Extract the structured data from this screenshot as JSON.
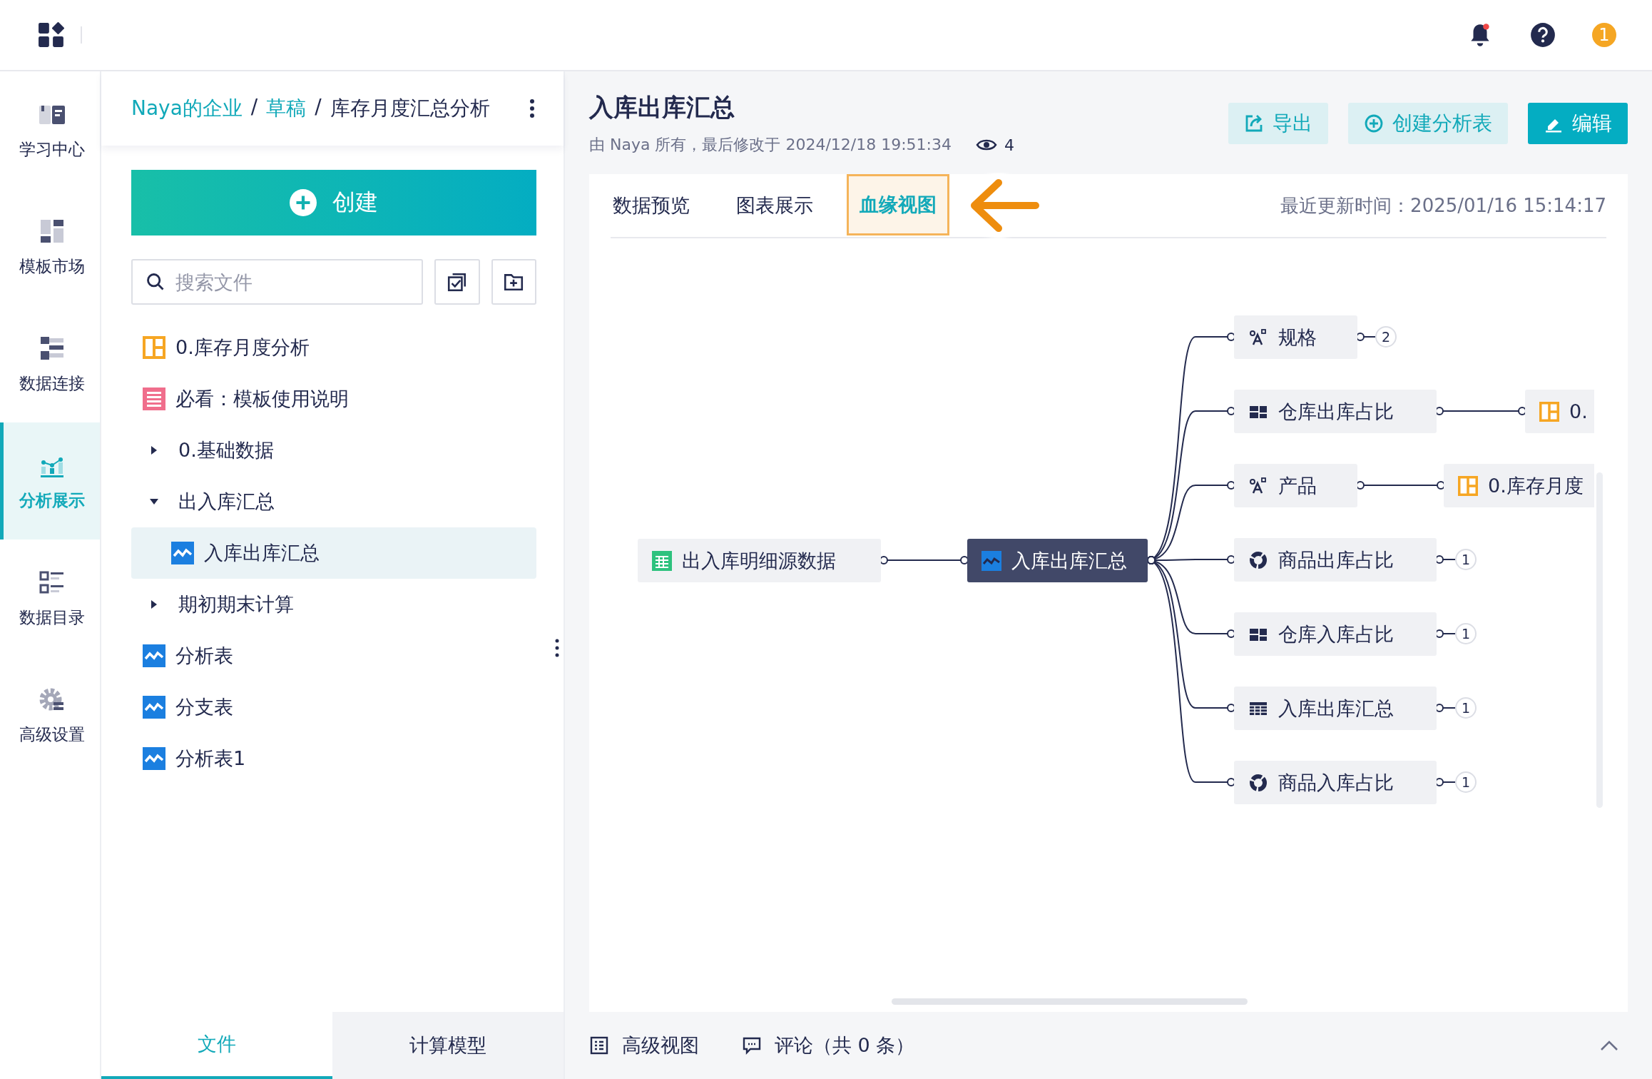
{
  "top_bar": {
    "user_badge": "1"
  },
  "nav_rail": [
    {
      "label": "学习中心",
      "kind": "book",
      "selected": false
    },
    {
      "label": "模板市场",
      "kind": "template",
      "selected": false
    },
    {
      "label": "数据连接",
      "kind": "connect",
      "selected": false
    },
    {
      "label": "分析展示",
      "kind": "chart",
      "selected": true
    },
    {
      "label": "数据目录",
      "kind": "catalog",
      "selected": false
    },
    {
      "label": "高级设置",
      "kind": "settings",
      "selected": false
    }
  ],
  "file_panel": {
    "breadcrumb": [
      {
        "label": "Naya的企业",
        "link": true
      },
      {
        "sep": "/",
        "label": "草稿",
        "link": true
      },
      {
        "sep": "/",
        "label": "库存月度汇总分析",
        "link": false
      }
    ],
    "create_button": "创建",
    "search": {
      "placeholder": "搜索文件"
    },
    "tree": [
      {
        "label": "0.库存月度分析",
        "kind": "dashboard",
        "selected": false
      },
      {
        "label": "必看：模板使用说明",
        "kind": "doc",
        "selected": false
      },
      {
        "label": "0.基础数据",
        "kind": "folder",
        "expanded": false,
        "selected": false
      },
      {
        "label": "出入库汇总",
        "kind": "folder",
        "expanded": true,
        "selected": false,
        "children": [
          {
            "label": "入库出库汇总",
            "kind": "analysis",
            "selected": true
          }
        ]
      },
      {
        "label": "期初期末计算",
        "kind": "folder",
        "expanded": false,
        "selected": false
      },
      {
        "label": "分析表",
        "kind": "analysis",
        "selected": false
      },
      {
        "label": "分支表",
        "kind": "analysis",
        "selected": false
      },
      {
        "label": "分析表1",
        "kind": "analysis",
        "selected": false
      }
    ],
    "bottom_tabs": [
      {
        "label": "文件",
        "selected": true
      },
      {
        "label": "计算模型",
        "selected": false
      }
    ]
  },
  "header": {
    "title": "入库出库汇总",
    "subtitle": "由 Naya 所有，最后修改于 2024/12/18 19:51:34",
    "views": "4",
    "buttons": [
      {
        "label": "导出",
        "kind": "export"
      },
      {
        "label": "创建分析表",
        "kind": "create"
      },
      {
        "label": "编辑",
        "kind": "edit"
      }
    ]
  },
  "tabs": [
    {
      "label": "数据预览",
      "selected": false
    },
    {
      "label": "图表展示",
      "selected": false
    },
    {
      "label": "血缘视图",
      "selected": true
    }
  ],
  "last_updated": "最近更新时间：2025/01/16 15:14:17",
  "lineage": {
    "source": {
      "label": "出入库明细源数据"
    },
    "center": {
      "label": "入库出库汇总"
    },
    "targets": [
      {
        "label": "规格",
        "kind": "field",
        "count": "2"
      },
      {
        "label": "仓库出库占比",
        "kind": "dashboard",
        "downstream": {
          "label": "0."
        }
      },
      {
        "label": "产品",
        "kind": "field",
        "downstream": {
          "label": "0.库存月度"
        }
      },
      {
        "label": "商品出库占比",
        "kind": "pie",
        "count": "1"
      },
      {
        "label": "仓库入库占比",
        "kind": "dashboard",
        "count": "1"
      },
      {
        "label": "入库出库汇总",
        "kind": "table",
        "count": "1"
      },
      {
        "label": "商品入库占比",
        "kind": "pie",
        "count": "1"
      }
    ]
  },
  "bottom_bar": {
    "advanced_view": "高级视图",
    "comments": "评论（共 0 条）"
  }
}
